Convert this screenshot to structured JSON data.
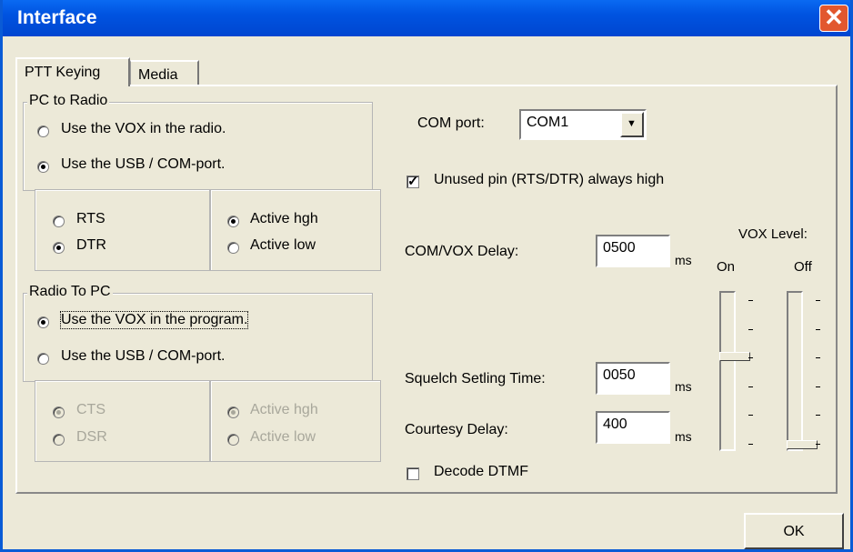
{
  "window": {
    "title": "Interface"
  },
  "tabs": [
    {
      "label": "PTT Keying"
    },
    {
      "label": "Media"
    }
  ],
  "pc_to_radio": {
    "title": "PC to Radio",
    "options": [
      {
        "label": "Use the VOX in the radio.",
        "checked": false
      },
      {
        "label": "Use the USB / COM-port.",
        "checked": true
      }
    ],
    "pins": [
      {
        "label": "RTS",
        "checked": false
      },
      {
        "label": "DTR",
        "checked": true
      }
    ],
    "levels": [
      {
        "label": "Active hgh",
        "checked": true
      },
      {
        "label": "Active low",
        "checked": false
      }
    ]
  },
  "radio_to_pc": {
    "title": "Radio To PC",
    "options": [
      {
        "label": "Use the VOX in the program.",
        "checked": true
      },
      {
        "label": "Use the USB / COM-port.",
        "checked": false
      }
    ],
    "pins": [
      {
        "label": "CTS",
        "checked": true
      },
      {
        "label": "DSR",
        "checked": false
      }
    ],
    "levels": [
      {
        "label": "Active hgh",
        "checked": true
      },
      {
        "label": "Active low",
        "checked": false
      }
    ]
  },
  "com_port": {
    "label": "COM port:",
    "value": "COM1"
  },
  "unused_pin": {
    "label": "Unused pin (RTS/DTR) always high",
    "checked": true
  },
  "com_vox_delay": {
    "label": "COM/VOX Delay:",
    "value": "0500",
    "unit": "ms"
  },
  "squelch": {
    "label": "Squelch Setling Time:",
    "value": "0050",
    "unit": "ms"
  },
  "courtesy": {
    "label": "Courtesy Delay:",
    "value": "400",
    "unit": "ms"
  },
  "decode_dtmf": {
    "label": "Decode DTMF",
    "checked": false
  },
  "vox_level": {
    "label": "VOX Level:",
    "on": {
      "label": "On",
      "position": 0.4
    },
    "off": {
      "label": "Off",
      "position": 1.0
    }
  },
  "ok_button": {
    "label": "OK"
  },
  "close_button": {
    "label": "✕"
  }
}
